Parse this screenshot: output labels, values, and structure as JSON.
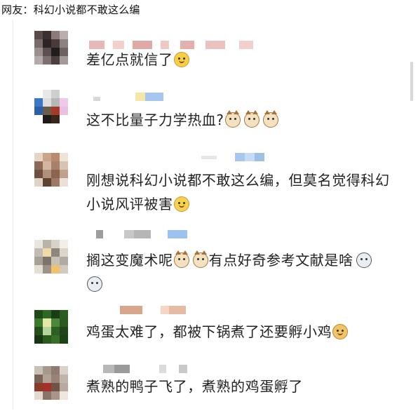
{
  "caption": "网友：科幻小说都不敢这么编",
  "comments": [
    {
      "text_before": "差亿点就信了",
      "emojis": [
        "smile-emoji"
      ]
    },
    {
      "text_before": "这不比量子力学热血?",
      "emojis": [
        "cat-emoji",
        "cat-emoji",
        "cat-emoji"
      ]
    },
    {
      "line1": "刚想说科幻小说都不敢这么编，但莫名觉得科幻",
      "line2": "小说风评被害",
      "emojis": [
        "laugh-emoji"
      ]
    },
    {
      "part1": "搁这变魔术呢",
      "part2": "有点好奇参考文献是啥",
      "emojis": [
        "cat-emoji",
        "cat-emoji",
        "husky-emoji",
        "husky-emoji"
      ]
    },
    {
      "text_before": "鸡蛋太难了，都被下锅煮了还要孵小鸡",
      "emojis": [
        "doge-emoji"
      ]
    },
    {
      "text_before": "煮熟的鸭子飞了，煮熟的鸡蛋孵了",
      "emojis": []
    }
  ]
}
